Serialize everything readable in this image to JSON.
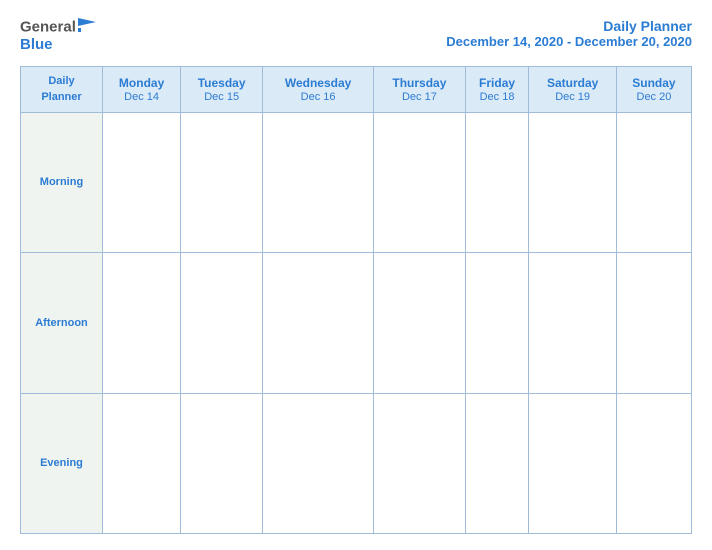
{
  "header": {
    "logo_general": "General",
    "logo_blue": "Blue",
    "title": "Daily Planner",
    "date_range": "December 14, 2020 - December 20, 2020"
  },
  "table": {
    "first_col_line1": "Daily",
    "first_col_line2": "Planner",
    "days": [
      {
        "name": "Monday",
        "date": "Dec 14"
      },
      {
        "name": "Tuesday",
        "date": "Dec 15"
      },
      {
        "name": "Wednesday",
        "date": "Dec 16"
      },
      {
        "name": "Thursday",
        "date": "Dec 17"
      },
      {
        "name": "Friday",
        "date": "Dec 18"
      },
      {
        "name": "Saturday",
        "date": "Dec 19"
      },
      {
        "name": "Sunday",
        "date": "Dec 20"
      }
    ],
    "rows": [
      {
        "label": "Morning"
      },
      {
        "label": "Afternoon"
      },
      {
        "label": "Evening"
      }
    ]
  }
}
